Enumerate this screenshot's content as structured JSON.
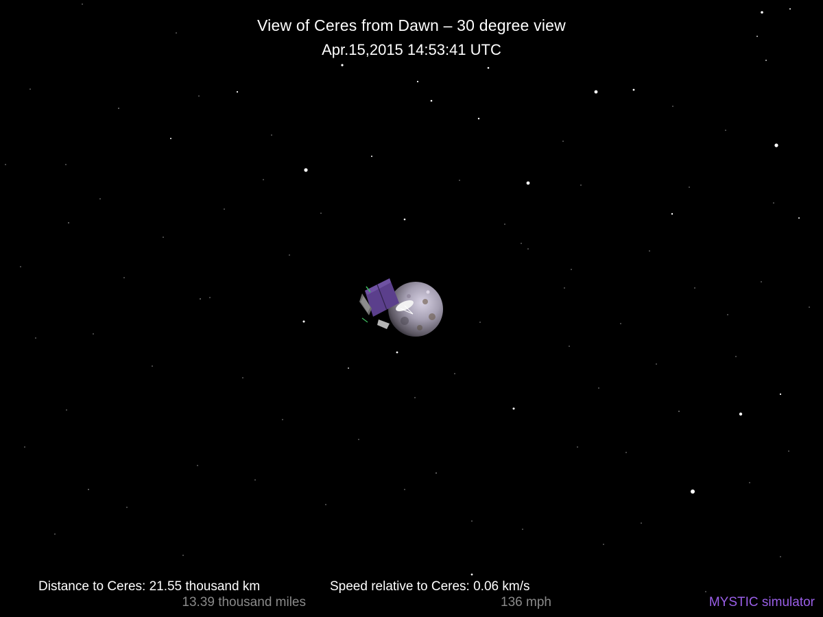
{
  "view": {
    "title": "View of Ceres from Dawn – 30 degree view",
    "timestamp": "Apr.15,2015 14:53:41  UTC"
  },
  "readouts": {
    "distance_label": "Distance to Ceres: 21.55 thousand km",
    "distance_miles": "13.39 thousand miles",
    "speed_label": "Speed relative to Ceres: 0.06 km/s",
    "speed_mph": "136 mph"
  },
  "credit": {
    "text": "MYSTIC simulator",
    "color": "#9a5fe8"
  },
  "colors": {
    "background": "#000000",
    "solar_panel": "#5b3f8c",
    "secondary_text": "#8a8a8a"
  },
  "icons": {
    "spacecraft": "dawn-spacecraft-icon",
    "planet": "ceres-dwarf-planet"
  }
}
